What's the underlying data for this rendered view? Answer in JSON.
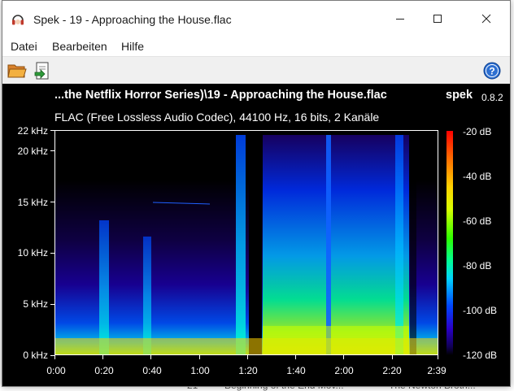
{
  "window": {
    "title": "Spek - 19 - Approaching the House.flac",
    "app_icon": "headphones-icon"
  },
  "menu": {
    "items": [
      "Datei",
      "Bearbeiten",
      "Hilfe"
    ]
  },
  "toolbar": {
    "open_icon": "folder-open-icon",
    "save_icon": "save-export-icon",
    "help_icon": "help-icon"
  },
  "spectrogram": {
    "file_title": "...the Netflix Horror Series)\\19 - Approaching the House.flac",
    "brand": "spek",
    "version": "0.8.2",
    "file_info": "FLAC (Free Lossless Audio Codec), 44100 Hz, 16 bits, 2 Kanäle",
    "freq_labels": [
      "22 kHz",
      "20 kHz",
      "15 kHz",
      "10 kHz",
      "5 kHz",
      "0 kHz"
    ],
    "freq_values_khz": [
      22,
      20,
      15,
      10,
      5,
      0
    ],
    "time_labels": [
      "0:00",
      "0:20",
      "0:40",
      "1:00",
      "1:20",
      "1:40",
      "2:00",
      "2:20",
      "2:39"
    ],
    "time_values_s": [
      0,
      20,
      40,
      60,
      80,
      100,
      120,
      140,
      159
    ],
    "db_labels": [
      "-20 dB",
      "-40 dB",
      "-60 dB",
      "-80 dB",
      "-100 dB",
      "-120 dB"
    ],
    "db_values": [
      -20,
      -40,
      -60,
      -80,
      -100,
      -120
    ],
    "duration_s": 159,
    "max_khz": 22,
    "colors": {
      "background": "#000000",
      "text": "#ffffff"
    }
  },
  "background_app": {
    "items": [
      "21",
      "Beginning of the End Mov...",
      "The Newton Broth..."
    ]
  }
}
